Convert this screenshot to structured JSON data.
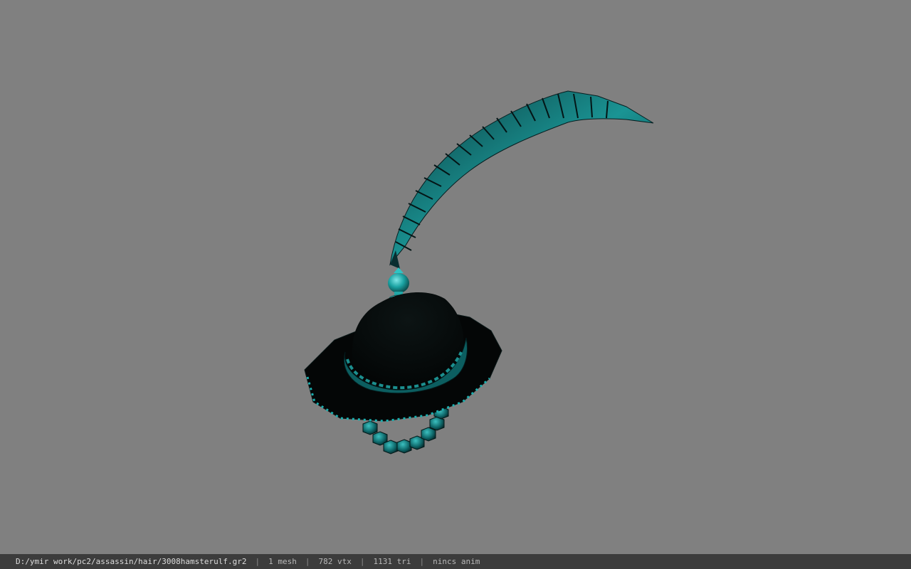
{
  "viewport": {
    "background": "#808080",
    "model_name": "hat-model"
  },
  "statusbar": {
    "path": "D:/ymir work/pc2/assassin/hair/3008hamsterulf.gr2",
    "separator": "|",
    "mesh": "1 mesh",
    "vertices": "782 vtx",
    "triangles": "1131 tri",
    "anim": "nincs anim"
  },
  "colors": {
    "accent": "#19a8a8",
    "accent_dark": "#0b4a4c",
    "hat_black": "#050707",
    "statusbar_bg": "#3c3c3c"
  }
}
